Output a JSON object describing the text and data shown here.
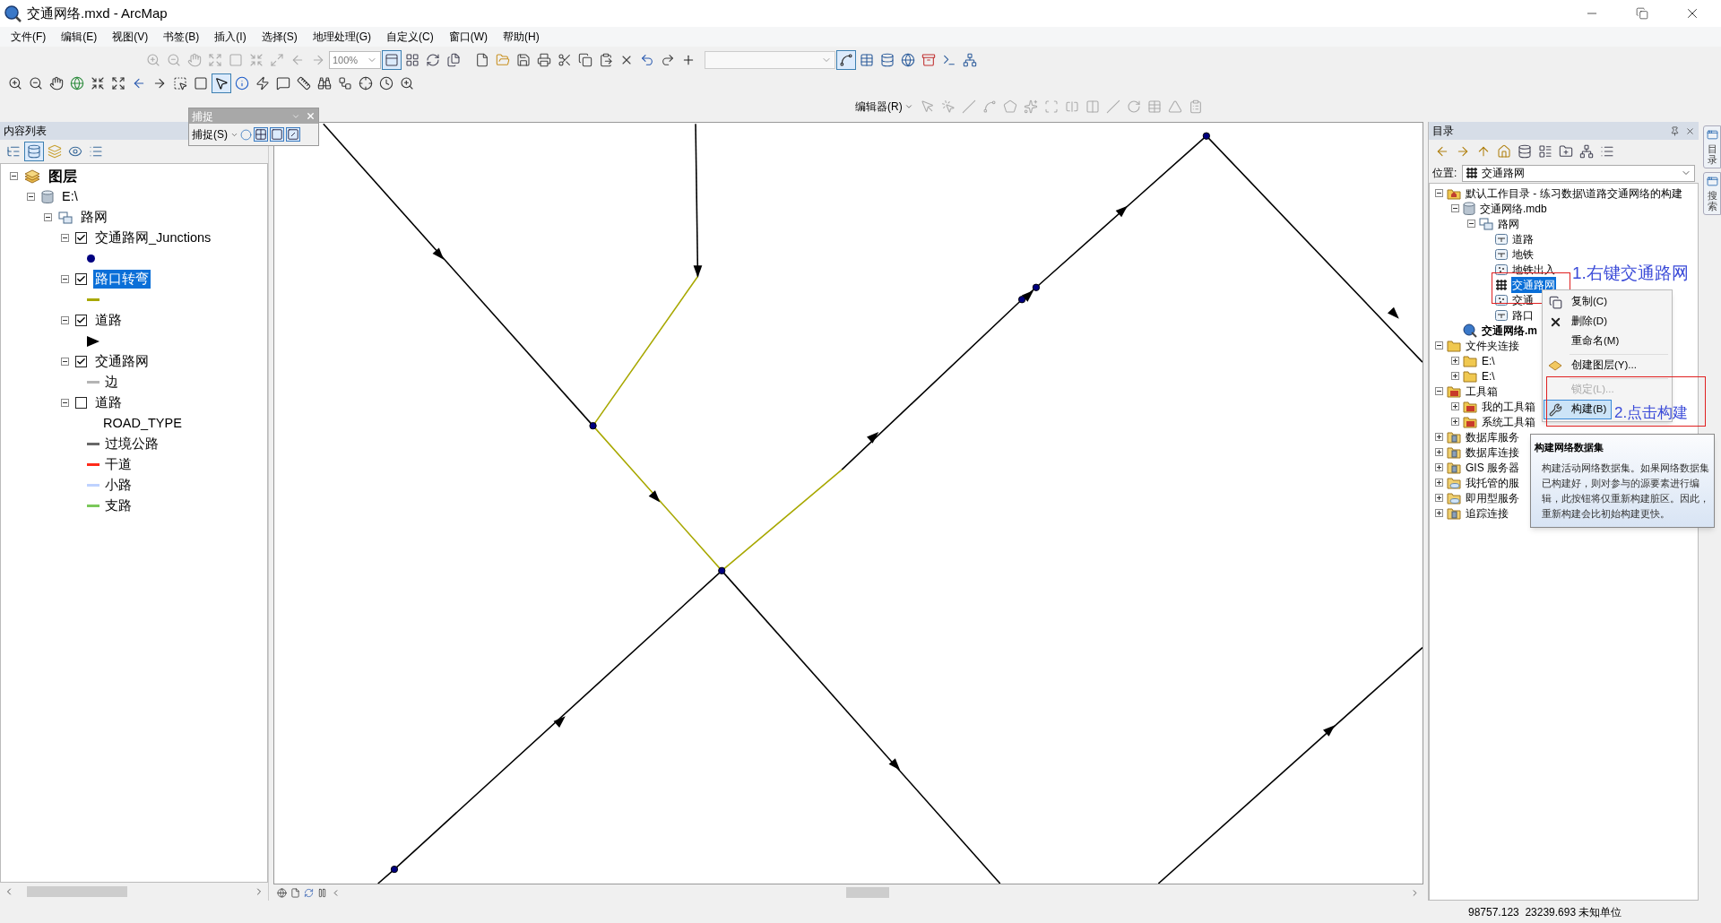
{
  "window": {
    "title": "交通网络.mxd - ArcMap"
  },
  "menu": [
    "文件(F)",
    "编辑(E)",
    "视图(V)",
    "书签(B)",
    "插入(I)",
    "选择(S)",
    "地理处理(G)",
    "自定义(C)",
    "窗口(W)",
    "帮助(H)"
  ],
  "toolbars": {
    "zoom_field": "100%",
    "editor_menu": "编辑器(R)"
  },
  "snapping": {
    "title": "捕捉",
    "menu": "捕捉(S)"
  },
  "toc": {
    "title": "内容列表",
    "tree": [
      {
        "kind": "layers",
        "label": "图层",
        "expanded": true,
        "children": [
          {
            "kind": "database",
            "label": "E:\\",
            "expanded": true,
            "children": [
              {
                "kind": "dataset",
                "label": "路网",
                "expanded": true,
                "children": [
                  {
                    "kind": "layer",
                    "label": "交通路网_Junctions",
                    "expanded": true,
                    "checked": true,
                    "selected": false,
                    "symbols": [
                      {
                        "kind": "point",
                        "color": "#000080"
                      }
                    ]
                  },
                  {
                    "kind": "layer",
                    "label": "路口转弯",
                    "expanded": true,
                    "checked": true,
                    "selected": true,
                    "symbols": [
                      {
                        "kind": "line",
                        "color": "#a8a800"
                      }
                    ]
                  },
                  {
                    "kind": "layer",
                    "label": "道路",
                    "expanded": true,
                    "checked": true,
                    "selected": false,
                    "symbols": [
                      {
                        "kind": "arrow",
                        "color": "#000000"
                      }
                    ]
                  },
                  {
                    "kind": "layer",
                    "label": "交通路网",
                    "expanded": true,
                    "checked": true,
                    "selected": false,
                    "symbols": [
                      {
                        "kind": "line",
                        "color": "#b4b4b4",
                        "label": "边"
                      }
                    ]
                  },
                  {
                    "kind": "layer",
                    "label": "道路",
                    "expanded": true,
                    "checked": false,
                    "selected": false,
                    "field": "ROAD_TYPE",
                    "symbols": [
                      {
                        "kind": "line",
                        "color": "#686868",
                        "label": "过境公路"
                      },
                      {
                        "kind": "line",
                        "color": "#ff2a1a",
                        "label": "干道"
                      },
                      {
                        "kind": "line",
                        "color": "#bed2ff",
                        "label": "小路"
                      },
                      {
                        "kind": "line",
                        "color": "#7ac85a",
                        "label": "支路"
                      }
                    ]
                  }
                ]
              }
            ]
          }
        ]
      }
    ]
  },
  "catalog": {
    "title": "目录",
    "location_label": "位置:",
    "location": "交通路网",
    "tree": [
      {
        "kind": "home",
        "label": "默认工作目录 - 练习数据\\道路交通网络的构建",
        "expanded": true,
        "selected": false,
        "children": [
          {
            "kind": "database",
            "label": "交通网络.mdb",
            "expanded": true,
            "selected": false,
            "children": [
              {
                "kind": "dataset",
                "label": "路网",
                "expanded": true,
                "selected": false,
                "children": [
                  {
                    "kind": "line",
                    "label": "道路",
                    "selected": false
                  },
                  {
                    "kind": "line",
                    "label": "地铁",
                    "selected": false
                  },
                  {
                    "kind": "point",
                    "label": "地铁出入",
                    "selected": false
                  },
                  {
                    "kind": "network",
                    "label": "交通路网",
                    "selected": true
                  },
                  {
                    "kind": "point",
                    "label": "交通",
                    "selected": false
                  },
                  {
                    "kind": "line",
                    "label": "路口",
                    "selected": false
                  }
                ]
              }
            ]
          },
          {
            "kind": "mxd",
            "label": "交通网络.m",
            "selected": false
          }
        ]
      },
      {
        "kind": "folder",
        "label": "文件夹连接",
        "expanded": true,
        "selected": false,
        "children": [
          {
            "kind": "folder",
            "label": "E:\\",
            "expanded": false,
            "selected": false
          },
          {
            "kind": "folder",
            "label": "E:\\",
            "expanded": false,
            "selected": false
          }
        ]
      },
      {
        "kind": "toolbox",
        "label": "工具箱",
        "expanded": true,
        "selected": false,
        "children": [
          {
            "kind": "toolbox",
            "label": "我的工具箱",
            "expanded": false,
            "selected": false
          },
          {
            "kind": "toolbox",
            "label": "系统工具箱",
            "expanded": false,
            "selected": false
          }
        ]
      },
      {
        "kind": "server",
        "label": "数据库服务",
        "expanded": false,
        "selected": false
      },
      {
        "kind": "server",
        "label": "数据库连接",
        "expanded": false,
        "selected": false
      },
      {
        "kind": "server",
        "label": "GIS 服务器",
        "expanded": false,
        "selected": false
      },
      {
        "kind": "cloud",
        "label": "我托管的服",
        "expanded": false,
        "selected": false
      },
      {
        "kind": "cloud",
        "label": "即用型服务",
        "expanded": false,
        "selected": false
      },
      {
        "kind": "server",
        "label": "追踪连接",
        "expanded": false,
        "selected": false
      }
    ]
  },
  "context_menu": [
    {
      "kind": "copy",
      "label": "复制(C)",
      "disabled": false,
      "selected": false,
      "divider_before": false
    },
    {
      "kind": "delete",
      "label": "删除(D)",
      "disabled": false,
      "selected": false,
      "divider_before": false
    },
    {
      "kind": "rename",
      "label": "重命名(M)",
      "disabled": false,
      "selected": false,
      "divider_before": false
    },
    {
      "kind": "layer",
      "label": "创建图层(Y)...",
      "disabled": false,
      "selected": false,
      "divider_before": true
    },
    {
      "kind": "lock",
      "label": "锁定(L)...",
      "disabled": true,
      "selected": false,
      "divider_before": true
    },
    {
      "kind": "build",
      "label": "构建(B)",
      "disabled": false,
      "selected": true,
      "divider_before": false
    }
  ],
  "tooltip": {
    "title": "构建网络数据集",
    "text": "构建活动网络数据集。如果网络数据集已构建好，则对参与的源要素进行编辑，此按钮将仅重新构建脏区。因此，重新构建会比初始构建更快。"
  },
  "annotations": [
    "1.右键交通路网",
    "2.点击构建"
  ],
  "side_tabs": [
    "目录",
    "搜索"
  ],
  "status_bar": {
    "coordinates": "98757.123  23239.693 未知单位"
  }
}
